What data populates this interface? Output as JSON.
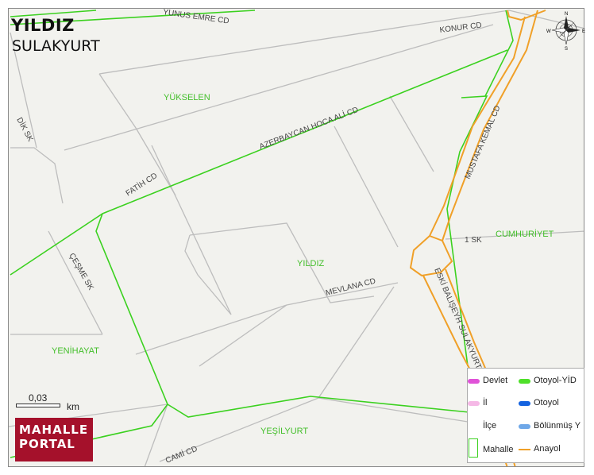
{
  "title": "YILDIZ",
  "subtitle": "SULAKYURT",
  "brand": {
    "line1": "MAHALLE",
    "line2": "PORTAL"
  },
  "scale": {
    "value": "0,03",
    "unit": "km"
  },
  "compass": {
    "n": "N",
    "s": "S",
    "e": "E",
    "w": "W"
  },
  "colors": {
    "background": "#f2f2ee",
    "street": "#bdbdbd",
    "boundary": "#3bd11f",
    "anayol": "#f0a028",
    "label_mahalle": "#43bf2a",
    "label_street": "#444444",
    "brand": "#a5112b"
  },
  "streets": {
    "yunus_emre": "YUNUS EMRE CD",
    "konur": "KONUR CD",
    "dik": "DİK SK",
    "azerbaycan": "AZERBAYCAN HOCA ALİ CD",
    "fatih": "FATİH CD",
    "mustafa_kemal": "MUSTAFA KEMAL CD",
    "bir_sk": "1 SK",
    "cesme": "ÇEŞME SK",
    "mevlana": "MEVLANA CD",
    "eski_baliseyh": "ESKİ BALIŞEYH SULAKYURT",
    "cami": "CAMİ CD"
  },
  "mahalleler": {
    "yukselen": "YÜKSELEN",
    "yildiz": "YILDIZ",
    "cumhuriyet": "CUMHURİYET",
    "yenihayat": "YENİHAYAT",
    "yesilyurt": "YEŞİLYURT"
  },
  "legend": [
    {
      "label": "Devlet",
      "color": "#e052d8",
      "shape": "pill"
    },
    {
      "label": "Otoyol-YİD",
      "color": "#4fe02a",
      "shape": "pill"
    },
    {
      "label": "İl",
      "color": "#f5b8e6",
      "shape": "pill"
    },
    {
      "label": "Otoyol",
      "color": "#1463e0",
      "shape": "pill"
    },
    {
      "label": "İlçe",
      "color": "#ffffff",
      "shape": "pill"
    },
    {
      "label": "Bölünmüş Y",
      "color": "#6fa8e8",
      "shape": "pill"
    },
    {
      "label": "Mahalle",
      "color": "#3bd11f",
      "shape": "box"
    },
    {
      "label": "Anayol",
      "color": "#f0a028",
      "shape": "line"
    }
  ]
}
